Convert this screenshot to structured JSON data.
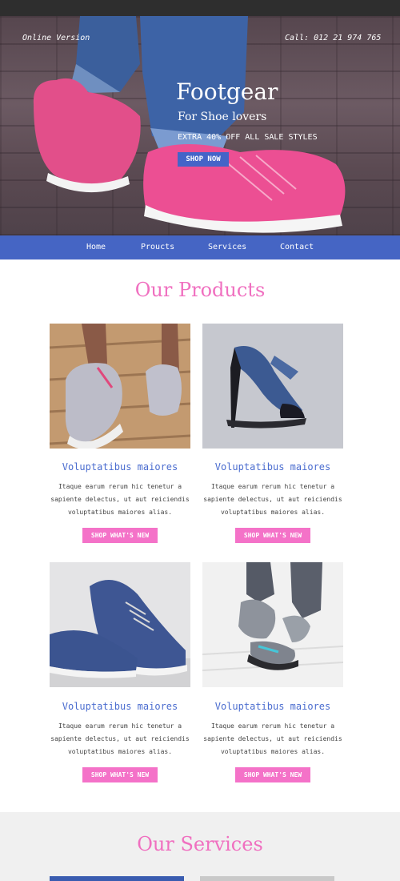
{
  "header": {
    "online_label": "Online Version",
    "call_label": "Call: 012 21 974 765"
  },
  "hero": {
    "brand": "Footgear",
    "tagline": "For Shoe lovers",
    "sale_text": "EXTRA 40% OFF ALL SALE STYLES",
    "cta_label": "SHOP NOW"
  },
  "nav": {
    "items": [
      {
        "label": "Home"
      },
      {
        "label": "Proucts"
      },
      {
        "label": "Services"
      },
      {
        "label": "Contact"
      }
    ]
  },
  "products": {
    "title": "Our Products",
    "items": [
      {
        "image": "grey-running-shoes-on-wood",
        "title": "Voluptatibus maiores",
        "desc_lines": [
          "Itaque earum rerum hic tenetur a",
          "sapiente delectus, ut aut reiciendis",
          "voluptatibus maiores alias."
        ],
        "button_label": "SHOP WHAT'S NEW"
      },
      {
        "image": "blue-strappy-high-heel",
        "title": "Voluptatibus maiores",
        "desc_lines": [
          "Itaque earum rerum hic tenetur a",
          "sapiente delectus, ut aut reiciendis",
          "voluptatibus maiores alias."
        ],
        "button_label": "SHOP WHAT'S NEW"
      },
      {
        "image": "navy-canvas-sneakers",
        "title": "Voluptatibus maiores",
        "desc_lines": [
          "Itaque earum rerum hic tenetur a",
          "sapiente delectus, ut aut reiciendis",
          "voluptatibus maiores alias."
        ],
        "button_label": "SHOP WHAT'S NEW"
      },
      {
        "image": "grey-running-shoes-walking",
        "title": "Voluptatibus maiores",
        "desc_lines": [
          "Itaque earum rerum hic tenetur a",
          "sapiente delectus, ut aut reiciendis",
          "voluptatibus maiores alias."
        ],
        "button_label": "SHOP WHAT'S NEW"
      }
    ]
  },
  "services": {
    "title": "Our Services"
  },
  "colors": {
    "accent_pink": "#f472c8",
    "accent_blue": "#4565c4",
    "title_pink": "#f070c0",
    "card_title_blue": "#4a6ccf"
  }
}
